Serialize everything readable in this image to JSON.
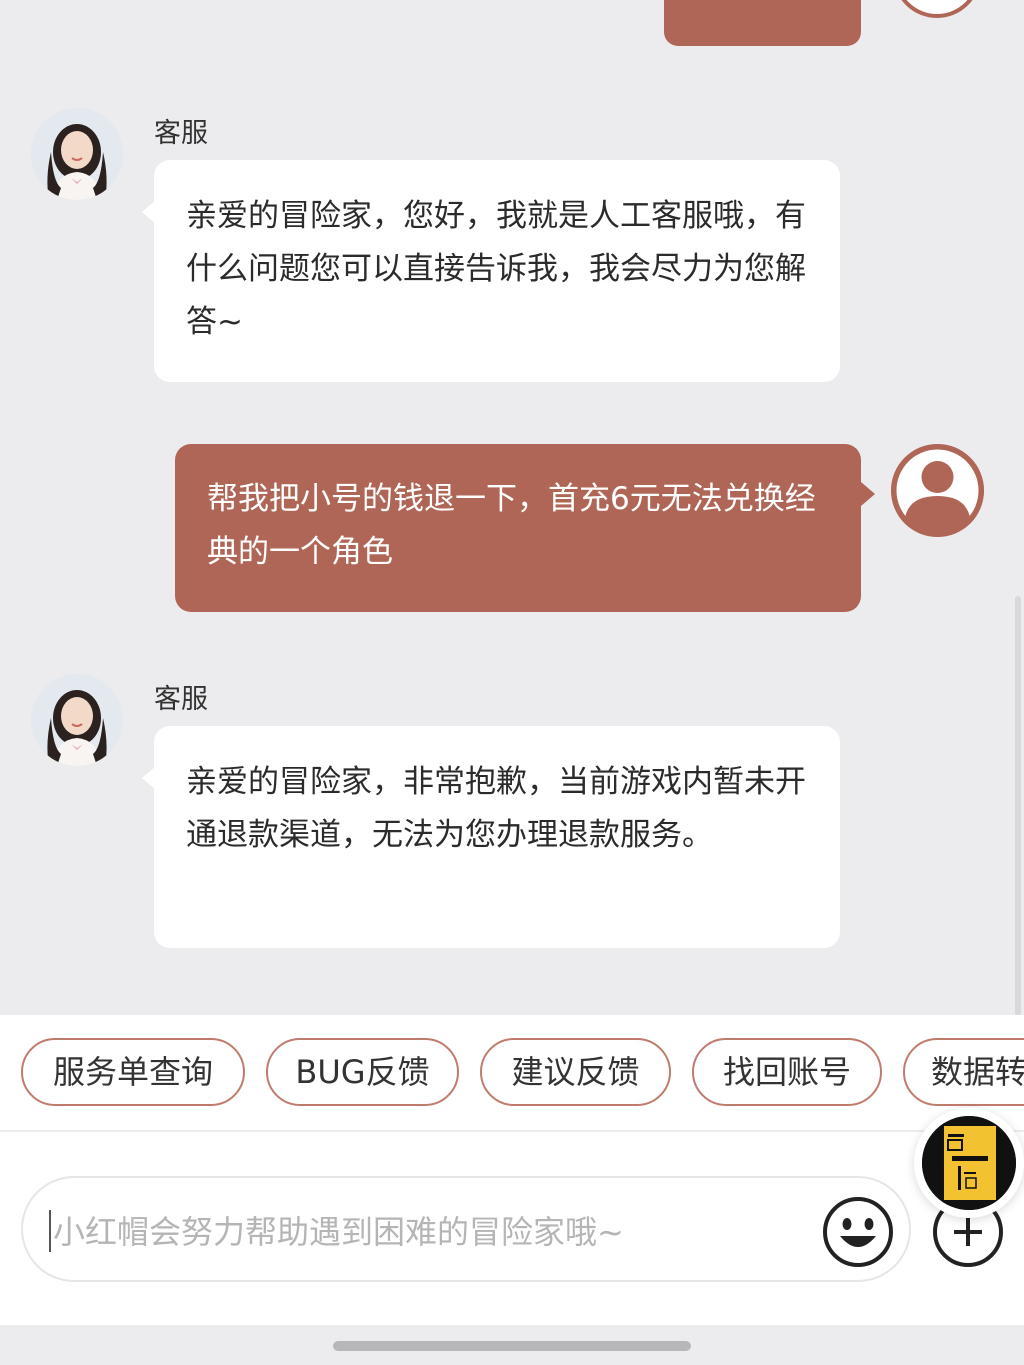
{
  "messages": [
    {
      "sender": "agent",
      "name": "客服",
      "text": "亲爱的冒险家，您好，我就是人工客服哦，有什么问题您可以直接告诉我，我会尽力为您解答~"
    },
    {
      "sender": "user",
      "text": "帮我把小号的钱退一下，首充6元无法兑换经典的一个角色"
    },
    {
      "sender": "agent",
      "name": "客服",
      "text": "亲爱的冒险家，非常抱歉，当前游戏内暂未开通退款渠道，无法为您办理退款服务。"
    }
  ],
  "quick_replies": [
    "服务单查询",
    "BUG反馈",
    "建议反馈",
    "找回账号",
    "数据转"
  ],
  "input": {
    "placeholder": "小红帽会努力帮助遇到困难的冒险家哦~"
  },
  "icons": {
    "emoji": "smiley-face-icon",
    "plus": "plus-circle-icon",
    "floating": "floating-logo-badge",
    "user_avatar": "user-silhouette-icon"
  },
  "colors": {
    "accent": "#b06657",
    "chip_border": "#c17b6d",
    "background": "#ececee",
    "bubble_agent": "#ffffff",
    "logo_yellow": "#f2c230"
  }
}
